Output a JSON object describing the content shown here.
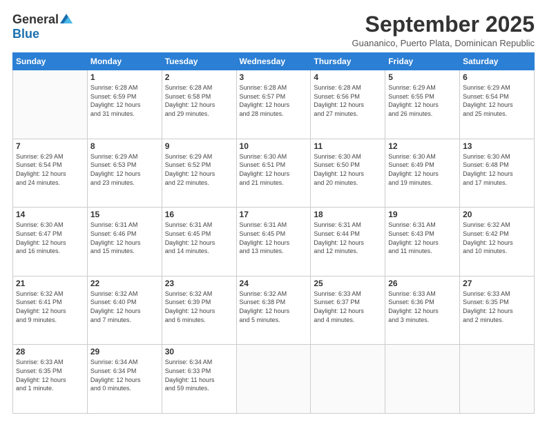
{
  "logo": {
    "general": "General",
    "blue": "Blue"
  },
  "header": {
    "month": "September 2025",
    "location": "Guananico, Puerto Plata, Dominican Republic"
  },
  "days_of_week": [
    "Sunday",
    "Monday",
    "Tuesday",
    "Wednesday",
    "Thursday",
    "Friday",
    "Saturday"
  ],
  "weeks": [
    [
      {
        "day": "",
        "info": ""
      },
      {
        "day": "1",
        "info": "Sunrise: 6:28 AM\nSunset: 6:59 PM\nDaylight: 12 hours\nand 31 minutes."
      },
      {
        "day": "2",
        "info": "Sunrise: 6:28 AM\nSunset: 6:58 PM\nDaylight: 12 hours\nand 29 minutes."
      },
      {
        "day": "3",
        "info": "Sunrise: 6:28 AM\nSunset: 6:57 PM\nDaylight: 12 hours\nand 28 minutes."
      },
      {
        "day": "4",
        "info": "Sunrise: 6:28 AM\nSunset: 6:56 PM\nDaylight: 12 hours\nand 27 minutes."
      },
      {
        "day": "5",
        "info": "Sunrise: 6:29 AM\nSunset: 6:55 PM\nDaylight: 12 hours\nand 26 minutes."
      },
      {
        "day": "6",
        "info": "Sunrise: 6:29 AM\nSunset: 6:54 PM\nDaylight: 12 hours\nand 25 minutes."
      }
    ],
    [
      {
        "day": "7",
        "info": "Sunrise: 6:29 AM\nSunset: 6:54 PM\nDaylight: 12 hours\nand 24 minutes."
      },
      {
        "day": "8",
        "info": "Sunrise: 6:29 AM\nSunset: 6:53 PM\nDaylight: 12 hours\nand 23 minutes."
      },
      {
        "day": "9",
        "info": "Sunrise: 6:29 AM\nSunset: 6:52 PM\nDaylight: 12 hours\nand 22 minutes."
      },
      {
        "day": "10",
        "info": "Sunrise: 6:30 AM\nSunset: 6:51 PM\nDaylight: 12 hours\nand 21 minutes."
      },
      {
        "day": "11",
        "info": "Sunrise: 6:30 AM\nSunset: 6:50 PM\nDaylight: 12 hours\nand 20 minutes."
      },
      {
        "day": "12",
        "info": "Sunrise: 6:30 AM\nSunset: 6:49 PM\nDaylight: 12 hours\nand 19 minutes."
      },
      {
        "day": "13",
        "info": "Sunrise: 6:30 AM\nSunset: 6:48 PM\nDaylight: 12 hours\nand 17 minutes."
      }
    ],
    [
      {
        "day": "14",
        "info": "Sunrise: 6:30 AM\nSunset: 6:47 PM\nDaylight: 12 hours\nand 16 minutes."
      },
      {
        "day": "15",
        "info": "Sunrise: 6:31 AM\nSunset: 6:46 PM\nDaylight: 12 hours\nand 15 minutes."
      },
      {
        "day": "16",
        "info": "Sunrise: 6:31 AM\nSunset: 6:45 PM\nDaylight: 12 hours\nand 14 minutes."
      },
      {
        "day": "17",
        "info": "Sunrise: 6:31 AM\nSunset: 6:45 PM\nDaylight: 12 hours\nand 13 minutes."
      },
      {
        "day": "18",
        "info": "Sunrise: 6:31 AM\nSunset: 6:44 PM\nDaylight: 12 hours\nand 12 minutes."
      },
      {
        "day": "19",
        "info": "Sunrise: 6:31 AM\nSunset: 6:43 PM\nDaylight: 12 hours\nand 11 minutes."
      },
      {
        "day": "20",
        "info": "Sunrise: 6:32 AM\nSunset: 6:42 PM\nDaylight: 12 hours\nand 10 minutes."
      }
    ],
    [
      {
        "day": "21",
        "info": "Sunrise: 6:32 AM\nSunset: 6:41 PM\nDaylight: 12 hours\nand 9 minutes."
      },
      {
        "day": "22",
        "info": "Sunrise: 6:32 AM\nSunset: 6:40 PM\nDaylight: 12 hours\nand 7 minutes."
      },
      {
        "day": "23",
        "info": "Sunrise: 6:32 AM\nSunset: 6:39 PM\nDaylight: 12 hours\nand 6 minutes."
      },
      {
        "day": "24",
        "info": "Sunrise: 6:32 AM\nSunset: 6:38 PM\nDaylight: 12 hours\nand 5 minutes."
      },
      {
        "day": "25",
        "info": "Sunrise: 6:33 AM\nSunset: 6:37 PM\nDaylight: 12 hours\nand 4 minutes."
      },
      {
        "day": "26",
        "info": "Sunrise: 6:33 AM\nSunset: 6:36 PM\nDaylight: 12 hours\nand 3 minutes."
      },
      {
        "day": "27",
        "info": "Sunrise: 6:33 AM\nSunset: 6:35 PM\nDaylight: 12 hours\nand 2 minutes."
      }
    ],
    [
      {
        "day": "28",
        "info": "Sunrise: 6:33 AM\nSunset: 6:35 PM\nDaylight: 12 hours\nand 1 minute."
      },
      {
        "day": "29",
        "info": "Sunrise: 6:34 AM\nSunset: 6:34 PM\nDaylight: 12 hours\nand 0 minutes."
      },
      {
        "day": "30",
        "info": "Sunrise: 6:34 AM\nSunset: 6:33 PM\nDaylight: 11 hours\nand 59 minutes."
      },
      {
        "day": "",
        "info": ""
      },
      {
        "day": "",
        "info": ""
      },
      {
        "day": "",
        "info": ""
      },
      {
        "day": "",
        "info": ""
      }
    ]
  ]
}
